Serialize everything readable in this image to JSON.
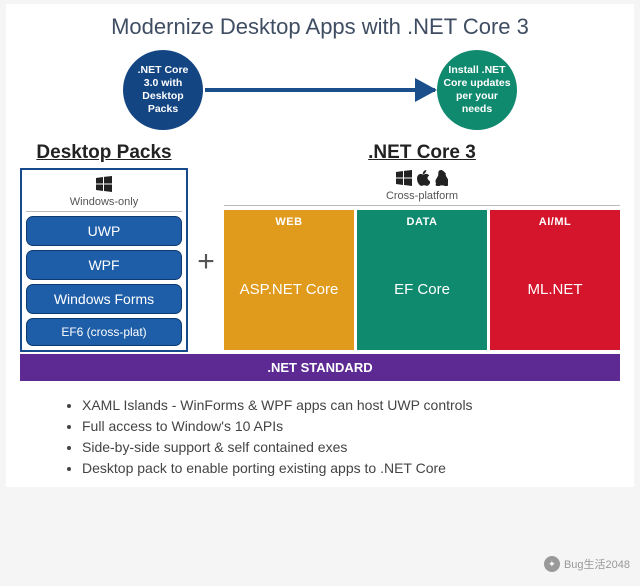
{
  "title": "Modernize Desktop Apps with .NET Core 3",
  "flow": {
    "left": ".NET Core 3.0 with Desktop Packs",
    "right": "Install .NET Core updates per your needs"
  },
  "left": {
    "heading": "Desktop Packs",
    "platform": "Windows-only",
    "items": [
      {
        "label": "UWP"
      },
      {
        "label": "WPF"
      },
      {
        "label": "Windows Forms"
      },
      {
        "label": "EF6 (cross-plat)"
      }
    ]
  },
  "plus": "+",
  "right": {
    "heading": ".NET Core 3",
    "platform": "Cross-platform",
    "columns": [
      {
        "header": "WEB",
        "label": "ASP.NET Core"
      },
      {
        "header": "DATA",
        "label": "EF Core"
      },
      {
        "header": "AI/ML",
        "label": "ML.NET"
      }
    ]
  },
  "standard": ".NET STANDARD",
  "bullets": [
    "XAML Islands - WinForms & WPF apps can host UWP controls",
    "Full access to Window's 10 APIs",
    "Side-by-side support & self contained exes",
    "Desktop pack to enable porting existing apps to .NET Core"
  ],
  "watermark": "Bug生活2048"
}
